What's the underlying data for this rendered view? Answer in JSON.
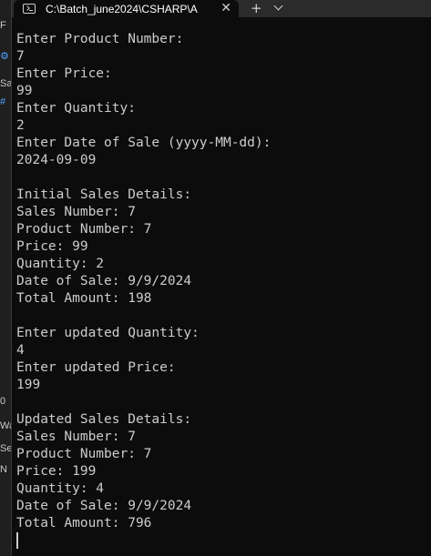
{
  "window": {
    "tab_title": "C:\\Batch_june2024\\CSHARP\\A",
    "new_tab_symbol": "+",
    "close_symbol": "✕"
  },
  "terminal": {
    "lines": [
      "Enter Product Number:",
      "7",
      "Enter Price:",
      "99",
      "Enter Quantity:",
      "2",
      "Enter Date of Sale (yyyy-MM-dd):",
      "2024-09-09",
      "",
      "Initial Sales Details:",
      "Sales Number: 7",
      "Product Number: 7",
      "Price: 99",
      "Quantity: 2",
      "Date of Sale: 9/9/2024",
      "Total Amount: 198",
      "",
      "Enter updated Quantity:",
      "4",
      "Enter updated Price:",
      "199",
      "",
      "Updated Sales Details:",
      "Sales Number: 7",
      "Product Number: 7",
      "Price: 199",
      "Quantity: 4",
      "Date of Sale: 9/9/2024",
      "Total Amount: 796"
    ]
  },
  "background_fragments": [
    {
      "text": "F"
    },
    {
      "text": "⚙"
    },
    {
      "text": "Sal"
    },
    {
      "text": "#"
    },
    {
      "text": "0 "
    },
    {
      "text": "Wa"
    },
    {
      "text": "Se"
    },
    {
      "text": "N"
    }
  ]
}
